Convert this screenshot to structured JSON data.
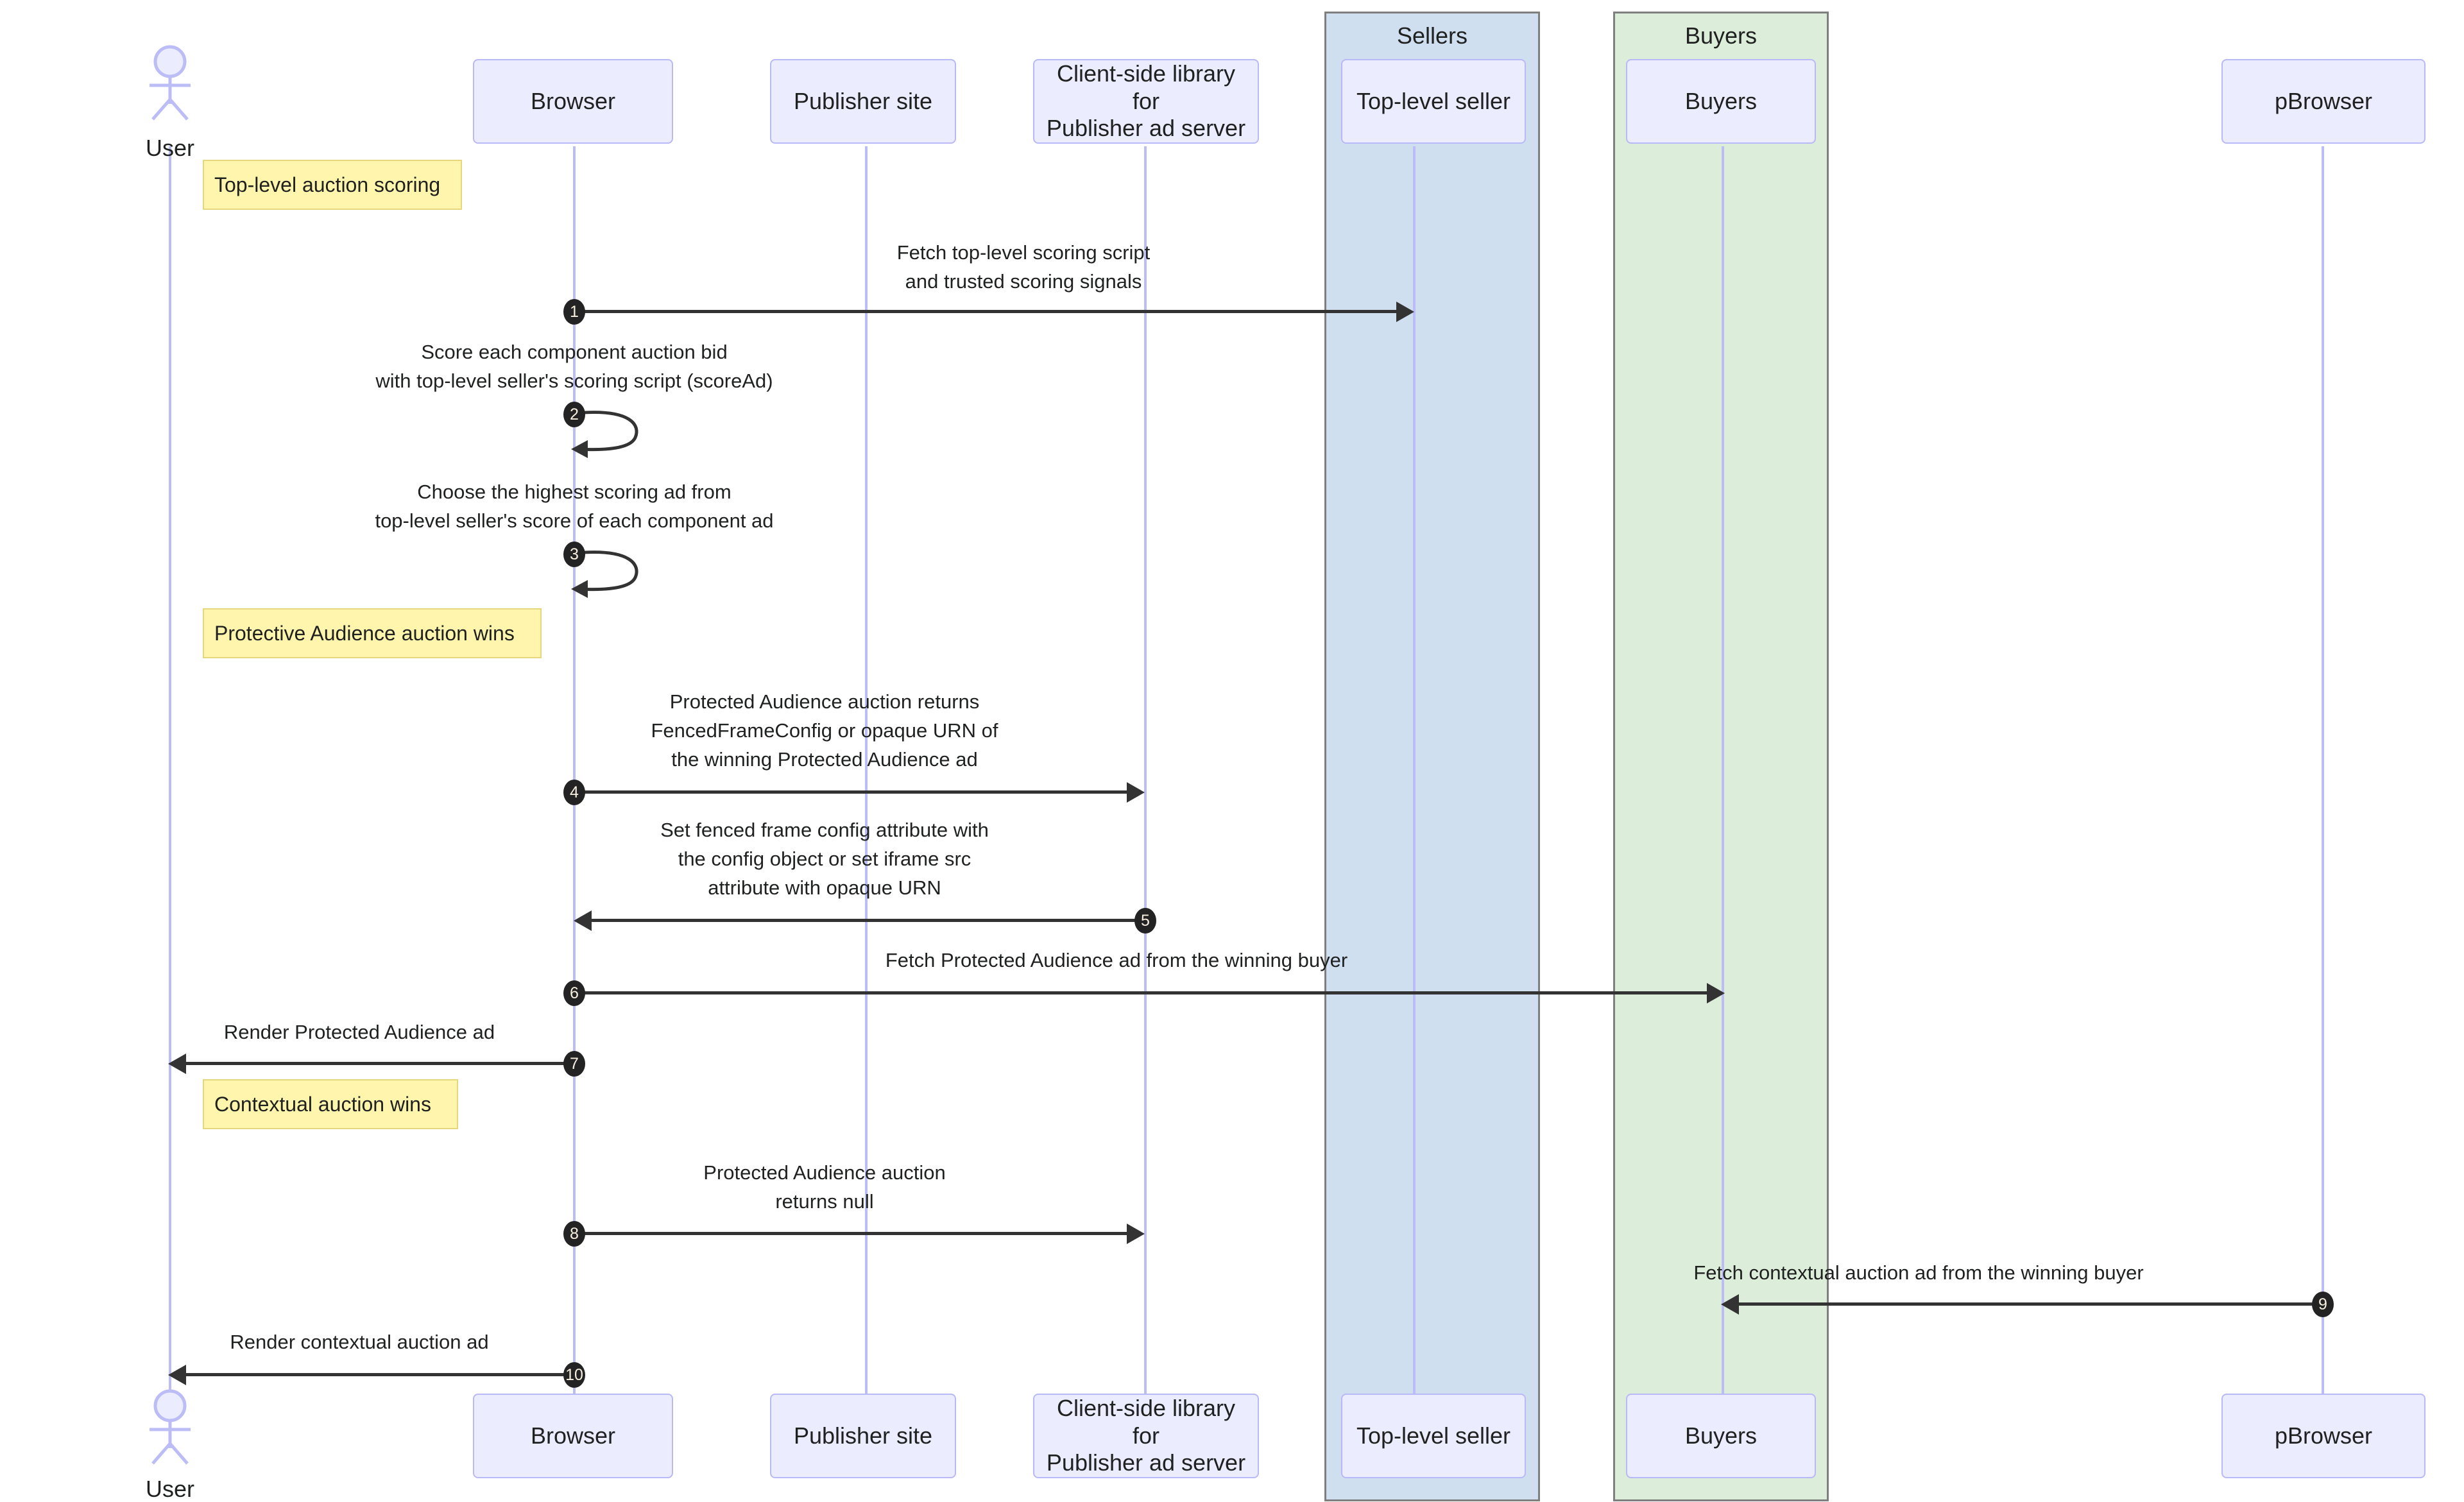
{
  "diagram": {
    "type": "sequence-diagram",
    "title": "Protected Audience top-level auction scoring sequence"
  },
  "groups": [
    {
      "id": "sellers",
      "label": "Sellers",
      "color": "#cfdff0",
      "border": "#7f7f7f"
    },
    {
      "id": "buyers",
      "label": "Buyers",
      "color": "#dcedd9",
      "border": "#7f7f7f"
    }
  ],
  "actors": [
    {
      "id": "user",
      "label": "User",
      "kind": "stick-figure"
    }
  ],
  "participants": [
    {
      "id": "browser",
      "label": "Browser"
    },
    {
      "id": "pubsite",
      "label": "Publisher site"
    },
    {
      "id": "clientlib",
      "label": "Client-side library for\nPublisher ad server"
    },
    {
      "id": "topseller",
      "label": "Top-level seller"
    },
    {
      "id": "buyers",
      "label": "Buyers"
    },
    {
      "id": "pbrowser",
      "label": "pBrowser"
    }
  ],
  "notes": [
    {
      "id": "note-1",
      "label": "Top-level auction scoring"
    },
    {
      "id": "note-2",
      "label": "Protective Audience auction wins"
    },
    {
      "id": "note-3",
      "label": "Contextual auction wins"
    }
  ],
  "messages": [
    {
      "num": "1",
      "text": "Fetch top-level scoring script\nand trusted scoring signals",
      "from": "browser",
      "to": "topseller",
      "direction": "right",
      "kind": "solid"
    },
    {
      "num": "2",
      "text": "Score each component auction bid\nwith top-level seller's scoring script (scoreAd)",
      "from": "browser",
      "to": "browser",
      "direction": "self",
      "kind": "solid"
    },
    {
      "num": "3",
      "text": "Choose the highest scoring ad from\ntop-level seller's score of each component ad",
      "from": "browser",
      "to": "browser",
      "direction": "self",
      "kind": "solid"
    },
    {
      "num": "4",
      "text": "Protected Audience auction returns\nFencedFrameConfig or opaque URN of\nthe winning Protected Audience ad",
      "from": "browser",
      "to": "clientlib",
      "direction": "right",
      "kind": "solid"
    },
    {
      "num": "5",
      "text": "Set fenced frame config attribute with\nthe config object or set iframe src\nattribute with opaque URN",
      "from": "clientlib",
      "to": "browser",
      "direction": "left",
      "kind": "solid"
    },
    {
      "num": "6",
      "text": "Fetch Protected Audience ad from the winning buyer",
      "from": "browser",
      "to": "buyers",
      "direction": "right",
      "kind": "solid"
    },
    {
      "num": "7",
      "text": "Render Protected Audience ad",
      "from": "browser",
      "to": "user",
      "direction": "left",
      "kind": "solid"
    },
    {
      "num": "8",
      "text": "Protected Audience auction\nreturns null",
      "from": "browser",
      "to": "clientlib",
      "direction": "right",
      "kind": "solid"
    },
    {
      "num": "9",
      "text": "Fetch contextual auction ad from the winning buyer",
      "from": "pbrowser",
      "to": "buyers",
      "direction": "left",
      "kind": "solid"
    },
    {
      "num": "10",
      "text": "Render contextual auction ad",
      "from": "browser",
      "to": "user",
      "direction": "left",
      "kind": "solid"
    }
  ]
}
